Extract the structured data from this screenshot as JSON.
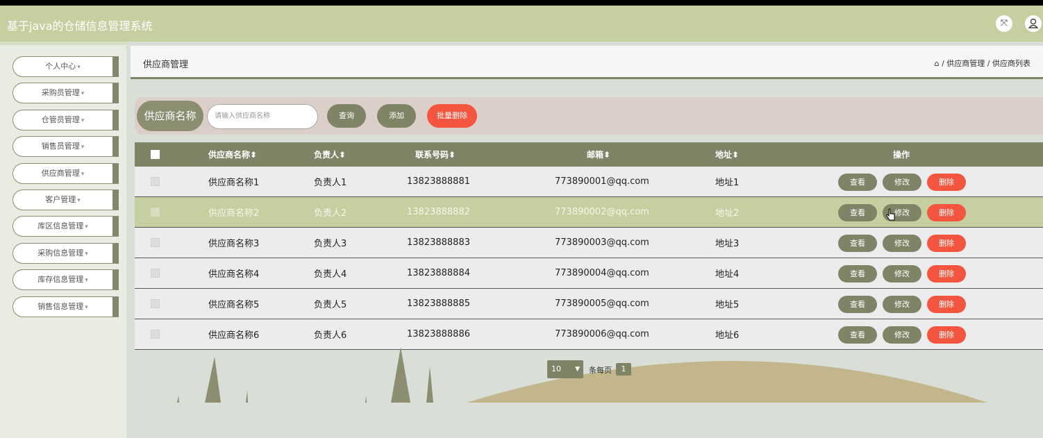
{
  "app": {
    "title": "基于java的仓储信息管理系统"
  },
  "icons": {
    "fullscreen": "expand-icon",
    "user": "user-icon",
    "home": "home-icon",
    "caret": "caret-down-icon"
  },
  "colors": {
    "topbar": "#c5cf9f",
    "olive": "#7f8467",
    "danger": "#f4553e",
    "highlight": "#c5cf9f"
  },
  "sidebar": {
    "items": [
      {
        "label": "个人中心"
      },
      {
        "label": "采购员管理"
      },
      {
        "label": "仓管员管理"
      },
      {
        "label": "销售员管理"
      },
      {
        "label": "供应商管理"
      },
      {
        "label": "客户管理"
      },
      {
        "label": "库区信息管理"
      },
      {
        "label": "采购信息管理"
      },
      {
        "label": "库存信息管理"
      },
      {
        "label": "销售信息管理"
      }
    ]
  },
  "header": {
    "title": "供应商管理",
    "breadcrumb": "/ 供应商管理 / 供应商列表"
  },
  "search": {
    "label": "供应商名称",
    "placeholder": "请输入供应商名称",
    "query_label": "查询",
    "add_label": "添加",
    "batch_delete_label": "批量删除"
  },
  "table": {
    "columns": [
      "供应商名称",
      "负责人",
      "联系号码",
      "邮箱",
      "地址",
      "操作"
    ],
    "rows": [
      {
        "name": "供应商名称1",
        "person": "负责人1",
        "phone": "13823888881",
        "email": "773890001@qq.com",
        "address": "地址1"
      },
      {
        "name": "供应商名称2",
        "person": "负责人2",
        "phone": "13823888882",
        "email": "773890002@qq.com",
        "address": "地址2"
      },
      {
        "name": "供应商名称3",
        "person": "负责人3",
        "phone": "13823888883",
        "email": "773890003@qq.com",
        "address": "地址3"
      },
      {
        "name": "供应商名称4",
        "person": "负责人4",
        "phone": "13823888884",
        "email": "773890004@qq.com",
        "address": "地址4"
      },
      {
        "name": "供应商名称5",
        "person": "负责人5",
        "phone": "13823888885",
        "email": "773890005@qq.com",
        "address": "地址5"
      },
      {
        "name": "供应商名称6",
        "person": "负责人6",
        "phone": "13823888886",
        "email": "773890006@qq.com",
        "address": "地址6"
      }
    ],
    "actions": {
      "view": "查看",
      "edit": "修改",
      "delete": "删除"
    },
    "sort_icon": "sort-icon"
  },
  "pagination": {
    "page_size": "10",
    "per_page_label": "条每页",
    "current_page": "1"
  }
}
